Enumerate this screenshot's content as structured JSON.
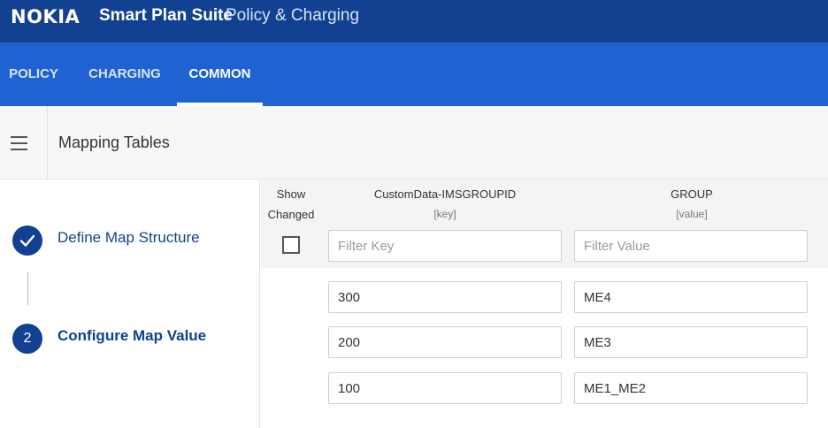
{
  "header": {
    "logo": "NOKIA",
    "app_title": "Smart Plan Suite",
    "app_subtitle": "Policy & Charging"
  },
  "nav": {
    "tabs": [
      {
        "label": "POLICY",
        "active": false
      },
      {
        "label": "CHARGING",
        "active": false
      },
      {
        "label": "COMMON",
        "active": true
      }
    ]
  },
  "page": {
    "menu_icon": "hamburger-menu-icon",
    "title": "Mapping Tables"
  },
  "steps": [
    {
      "marker": "✓",
      "icon": "checkmark-icon",
      "label": "Define Map Structure",
      "state": "completed"
    },
    {
      "marker": "2",
      "label": "Configure Map Value",
      "state": "current"
    }
  ],
  "table": {
    "show_changed_line1": "Show",
    "show_changed_line2": "Changed",
    "key_column": "CustomData-IMSGROUPID",
    "key_sub": "[key]",
    "value_column": "GROUP",
    "value_sub": "[value]",
    "filter_key_placeholder": "Filter Key",
    "filter_value_placeholder": "Filter Value",
    "rows": [
      {
        "key": "300",
        "value": "ME4"
      },
      {
        "key": "200",
        "value": "ME3"
      },
      {
        "key": "100",
        "value": "ME1_ME2"
      }
    ]
  },
  "colors": {
    "topbar": "#124191",
    "navbar": "#1f62d1",
    "accent": "#124191"
  }
}
